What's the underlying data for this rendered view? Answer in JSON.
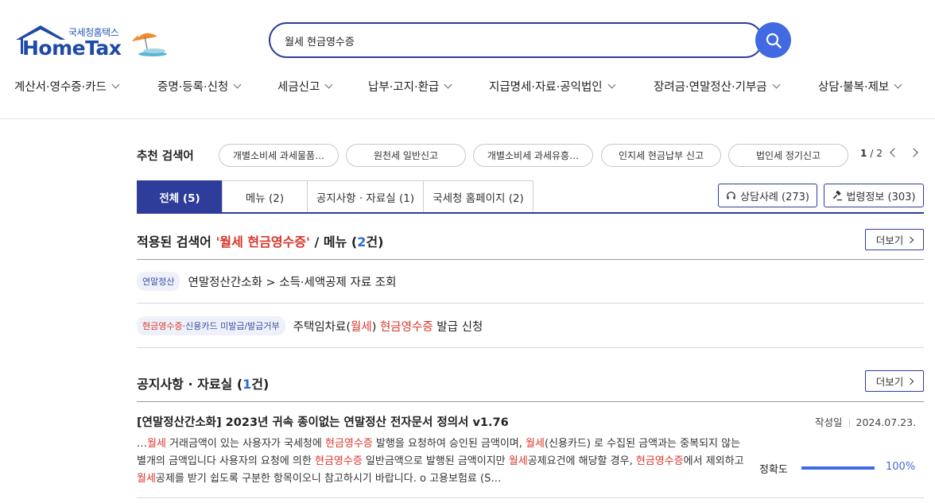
{
  "logo": {
    "small_text": "국세청홈택스",
    "big_text": "HomeTax"
  },
  "search": {
    "value": "월세 현금영수증",
    "button_icon": "search-icon"
  },
  "gnb": [
    {
      "label": "계산서·영수증·카드"
    },
    {
      "label": "증명·등록·신청"
    },
    {
      "label": "세금신고"
    },
    {
      "label": "납부·고지·환급"
    },
    {
      "label": "지급명세·자료·공익법인"
    },
    {
      "label": "장려금·연말정산·기부금"
    },
    {
      "label": "상담·불복·제보"
    }
  ],
  "recommended": {
    "title": "추천 검색어",
    "items": [
      "개별소비세 과세물품…",
      "원천세 일반신고",
      "개별소비세 과세유흥…",
      "인지세 현금납부 신고",
      "법인세 정기신고"
    ],
    "page_current": "1",
    "page_sep": "/",
    "page_total": "2"
  },
  "tabs": [
    {
      "label": "전체 (5)",
      "active": true
    },
    {
      "label": "메뉴 (2)"
    },
    {
      "label": "공지사항 · 자료실 (1)"
    },
    {
      "label": "국세청 홈페이지 (2)"
    }
  ],
  "side_buttons": {
    "consult": "상담사례 (273)",
    "law": "법령정보 (303)"
  },
  "menu_section": {
    "title_prefix": "적용된 검색어 ",
    "query": "'월세 현금영수증'",
    "title_mid": " / 메뉴 (",
    "count": "2",
    "title_suffix": "건)",
    "more": "더보기",
    "items": [
      {
        "tag": "연말정산",
        "text": "연말정산간소화 > 소득·세액공제 자료 조회"
      },
      {
        "tag_a": "현금영수증",
        "tag_b": "·신용카드 미발급/발급거부",
        "t1": "주택임차료(",
        "t2": "월세",
        "t3": ") ",
        "t4": "현금영수증",
        "t5": " 발급 신청"
      }
    ]
  },
  "notice_section": {
    "title_prefix": "공지사항 · 자료실 (",
    "count": "1",
    "title_suffix": "건)",
    "more": "더보기",
    "doc": {
      "title": "[연말정산간소화] 2023년 귀속 종이없는 연말정산 전자문서 정의서 v1.76",
      "author": "작성일",
      "date": "2024.07.23.",
      "body": [
        "…",
        "월세",
        " 거래금액이 있는 사용자가 국세청에 ",
        "현금영수증",
        " 발행을 요청하여 승인된 금액이며, ",
        "월세",
        "(신용카드) 로 수집된 금액과는 중복되지 않는 별개의 금액입니다 사용자의 요청에 의한 ",
        "현금영수증",
        " 일반금액으로 발행된 금액이지만 ",
        "월세",
        "공제요건에 해당할 경우, ",
        "현금영수증",
        "에서 제외하고 ",
        "월세",
        "공제를 받기 쉽도록 구분한 항목이오니 참고하시기 바랍니다. o 고용보험료 (S…"
      ],
      "accuracy_label": "정확도",
      "accuracy_value": "100%",
      "accuracy_fraction": 1.0
    }
  },
  "colors": {
    "navy": "#2d3d99",
    "accent": "#4169e1",
    "highlight": "#d9362b"
  }
}
